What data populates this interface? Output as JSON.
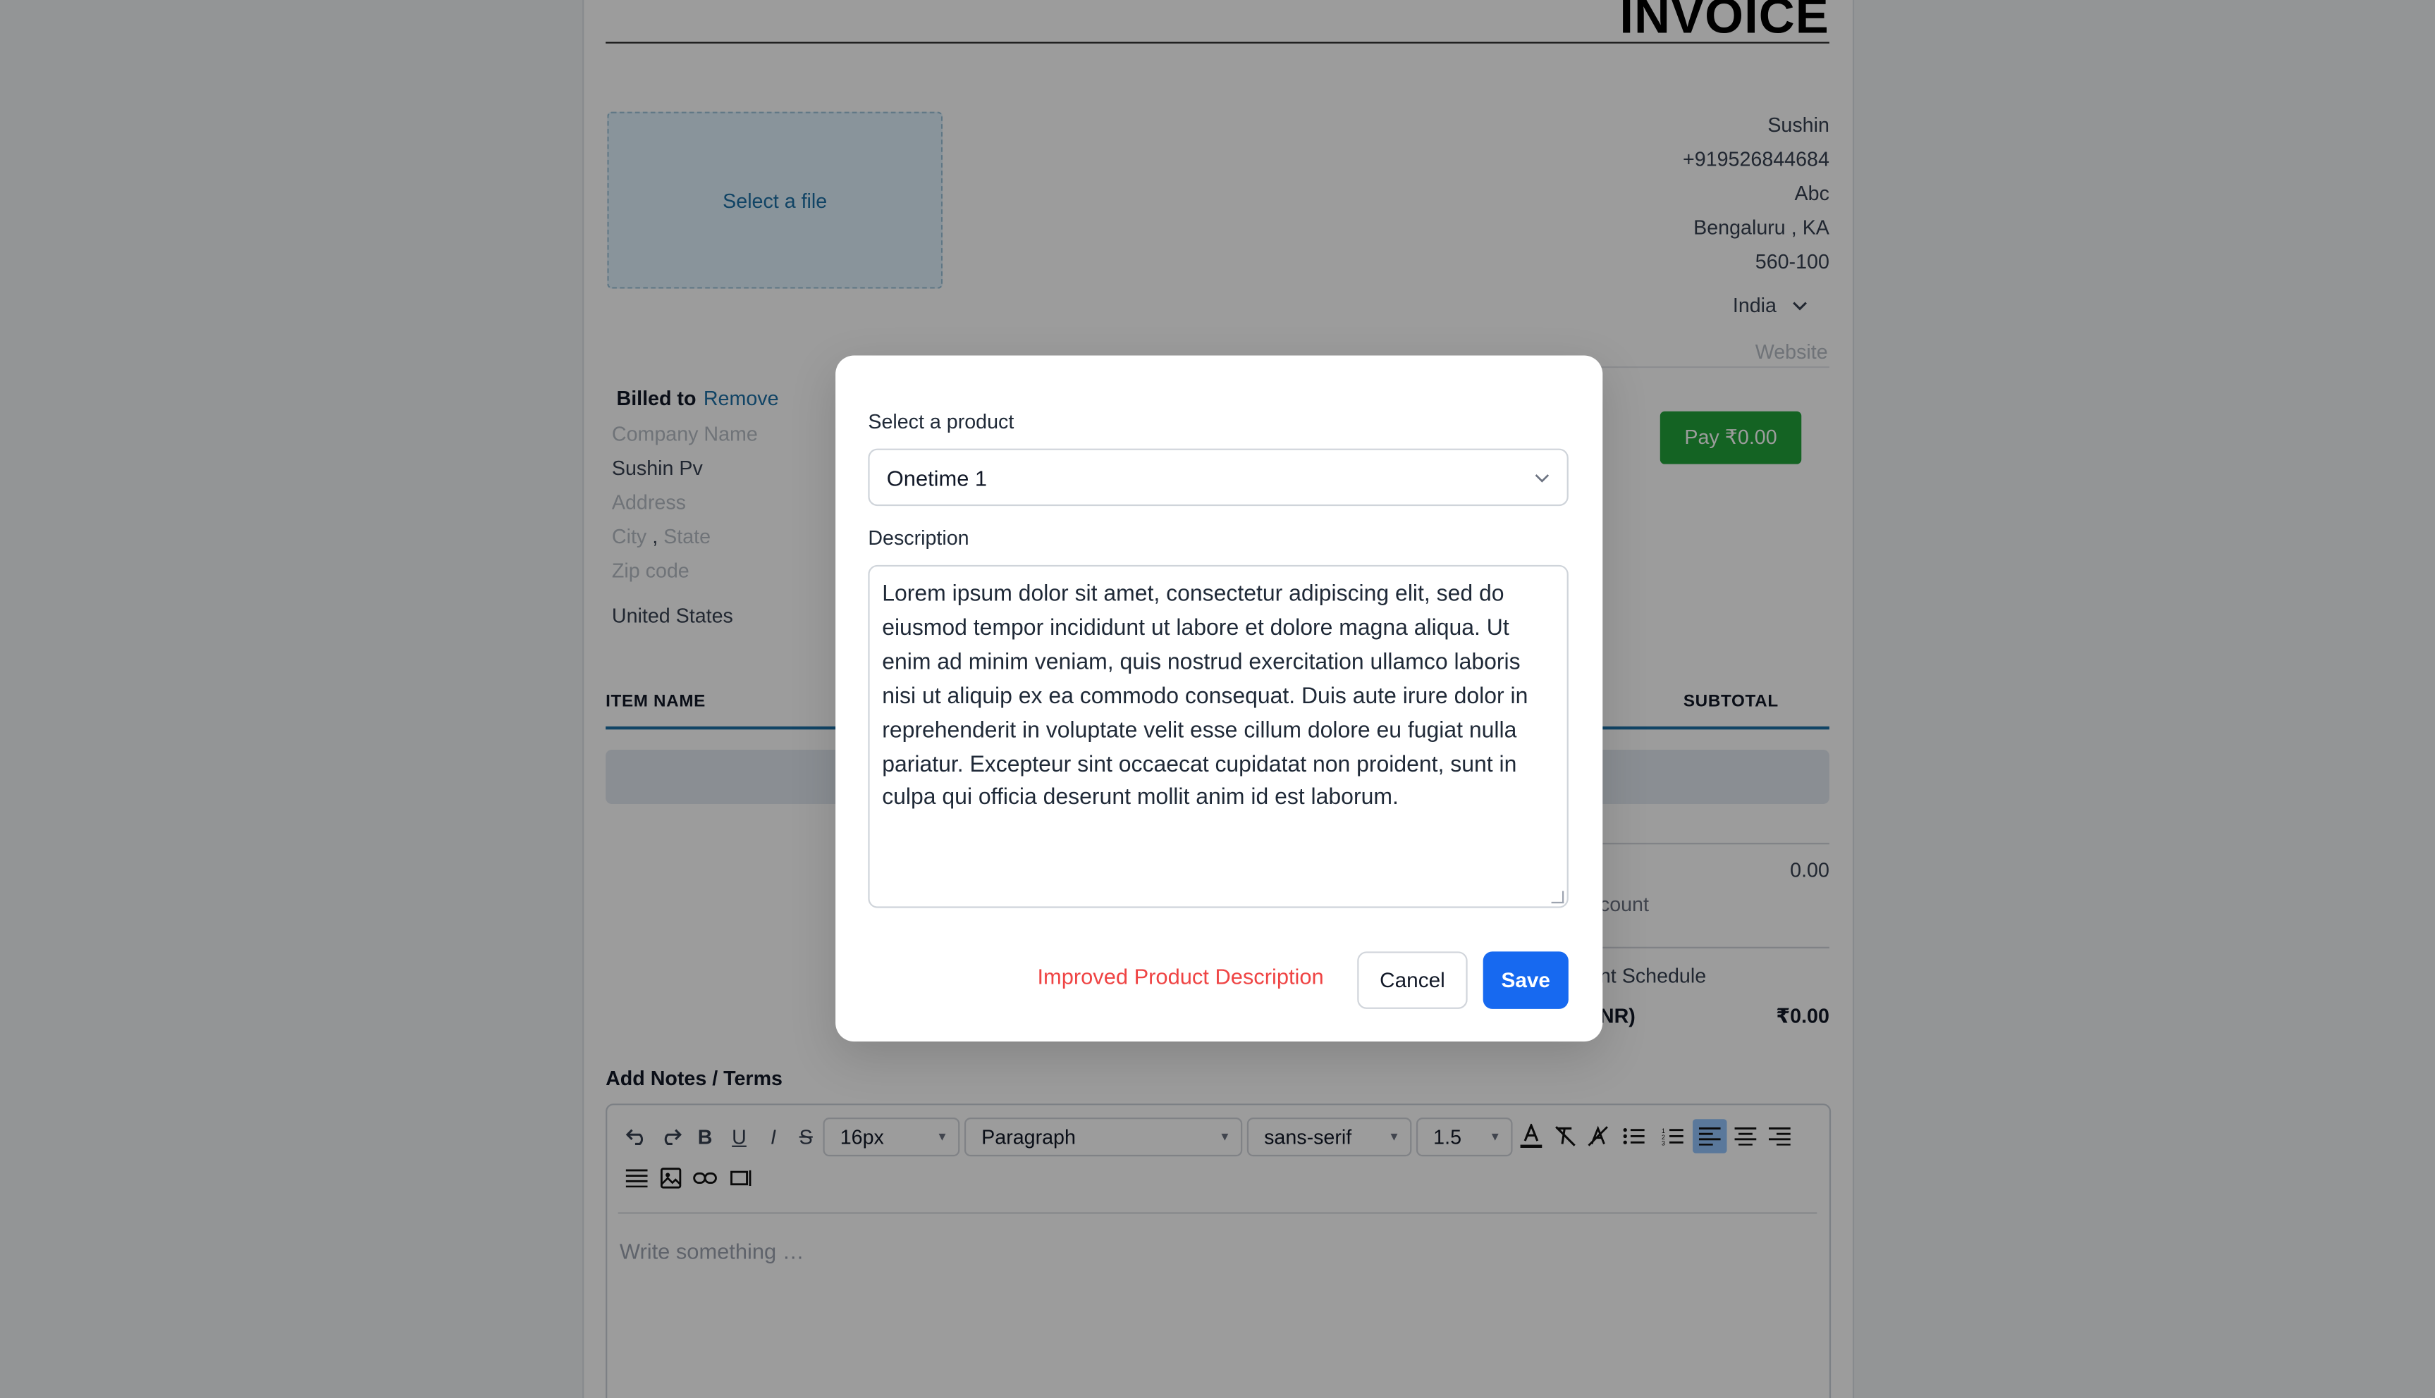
{
  "invoice": {
    "title": "INVOICE",
    "file_select_label": "Select a file",
    "sender": {
      "name": "Sushin",
      "phone": "+919526844684",
      "address": "Abc",
      "city": "Bengaluru",
      "city_sep": ",",
      "state": "KA",
      "zip": "560-100",
      "country": "India",
      "website_placeholder": "Website"
    },
    "billed_to": {
      "label": "Billed to",
      "remove_label": "Remove",
      "company_placeholder": "Company Name",
      "name": "Sushin Pv",
      "address_placeholder": "Address",
      "city_placeholder": "City",
      "city_sep": ",",
      "state_placeholder": "State",
      "zip_placeholder": "Zip code",
      "country": "United States"
    },
    "pay_button": "Pay ₹0.00",
    "columns": {
      "item_name": "ITEM NAME",
      "subtotal": "SUBTOTAL"
    },
    "summary": {
      "subtotal_value": "0.00",
      "discount_label_fragment": "count",
      "schedule_label_fragment": "nt Schedule",
      "total_label_fragment": "NR)",
      "total_value": "₹0.00"
    },
    "notes": {
      "label": "Add Notes / Terms",
      "placeholder": "Write something …",
      "toolbar": {
        "font_size": "16px",
        "block_type": "Paragraph",
        "font_family": "sans-serif",
        "line_height": "1.5"
      }
    }
  },
  "modal": {
    "product_label": "Select a product",
    "product_value": "Onetime 1",
    "description_label": "Description",
    "description_text": "Lorem ipsum dolor sit amet, consectetur adipiscing elit, sed do eiusmod tempor incididunt ut labore et dolore magna aliqua. Ut enim ad minim veniam, quis nostrud exercitation ullamco laboris nisi ut aliquip ex ea commodo consequat. Duis aute irure dolor in reprehenderit in voluptate velit esse cillum dolore eu fugiat nulla pariatur. Excepteur sint occaecat cupidatat non proident, sunt in culpa qui officia deserunt mollit anim id est laborum.",
    "improve_label": "Improved Product Description",
    "cancel_label": "Cancel",
    "save_label": "Save"
  },
  "colors": {
    "primary": "#1769f0",
    "pay_green": "#22a33a",
    "link_blue": "#1d6fa5",
    "warning_red": "#ef4444"
  }
}
